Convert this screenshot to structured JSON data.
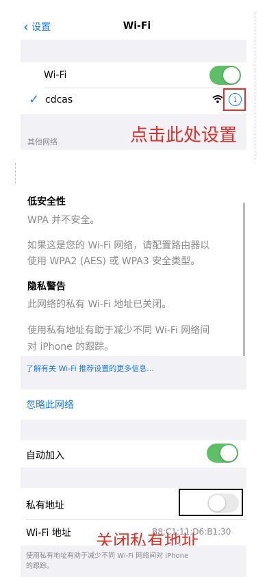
{
  "nav": {
    "back_label": "设置",
    "title": "Wi-Fi"
  },
  "wifi": {
    "label": "Wi-Fi",
    "enabled": true
  },
  "current_network": {
    "name": "cdcas"
  },
  "other_networks_header": "其他网络",
  "annotations": {
    "tap_here": "点击此处设置",
    "close_private": "关闭私有地址"
  },
  "security": {
    "title": "低安全性",
    "line1": "WPA 并不安全。",
    "desc_line1": "如果这是您的 Wi-Fi 网络，请配置路由器以",
    "desc_line2": "使用 WPA2 (AES) 或 WPA3 安全类型。"
  },
  "privacy": {
    "title": "隐私警告",
    "line1": "此网络的私有 Wi-Fi 地址已关闭。",
    "desc_line1": "使用私有地址有助于减少不同 Wi-Fi 网络间",
    "desc_line2": "对 iPhone 的跟踪。"
  },
  "learn_more": "了解有关 Wi-Fi 推荐设置的更多信息...",
  "forget_network": "忽略此网络",
  "auto_join": {
    "label": "自动加入",
    "enabled": true
  },
  "private_address": {
    "label": "私有地址",
    "enabled": false
  },
  "wifi_address": {
    "label": "Wi-Fi 地址",
    "value": "B8:C1:11:D6:B1:30"
  },
  "footer": {
    "line1": "使用私有地址有助于减少不同 Wi-Fi 网络间对 iPhone",
    "line2": "的跟踪。"
  },
  "colors": {
    "accent": "#1a7cf5",
    "toggle_on": "#5dbf66",
    "annotation_red": "#e0302a"
  }
}
